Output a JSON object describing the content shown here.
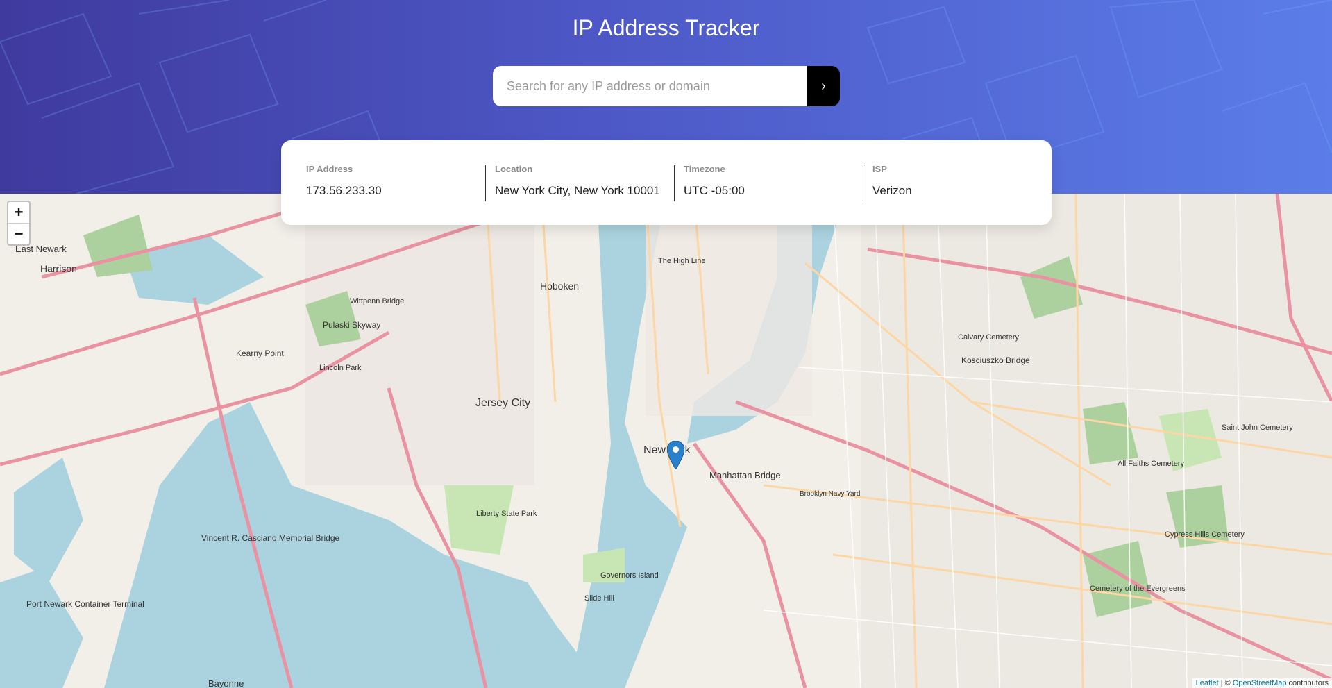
{
  "app": {
    "title": "IP Address Tracker"
  },
  "search": {
    "placeholder": "Search for any IP address or domain",
    "value": "",
    "button_icon": "chevron-right-icon"
  },
  "info": {
    "ip_label": "IP Address",
    "ip_value": "173.56.233.30",
    "location_label": "Location",
    "location_value": "New York City, New York 10001",
    "timezone_label": "Timezone",
    "timezone_value": "UTC -05:00",
    "isp_label": "ISP",
    "isp_value": "Verizon"
  },
  "map": {
    "zoom_in": "+",
    "zoom_out": "−",
    "attribution_leaflet": "Leaflet",
    "attribution_sep": " | © ",
    "attribution_osm": "OpenStreetMap",
    "attribution_suffix": " contributors",
    "labels": {
      "east_newark": "East Newark",
      "harrison": "Harrison",
      "hoboken": "Hoboken",
      "jersey_city": "Jersey City",
      "new_york": "New York",
      "manhattan_bridge": "Manhattan Bridge",
      "kosciuszko": "Kosciuszko Bridge",
      "calvary": "Calvary Cemetery",
      "liberty": "Liberty State Park",
      "governors": "Governors Island",
      "bayonne": "Bayonne",
      "port_newark": "Port Newark Container Terminal",
      "kearny": "Kearny Point",
      "pulaski": "Pulaski Skyway",
      "vincent": "Vincent R. Casciano Memorial Bridge",
      "high_line": "The High Line",
      "brooklyn_navy": "Brooklyn Navy Yard",
      "saint_john": "Saint John Cemetery",
      "cypress": "Cypress Hills Cemetery",
      "evergreens": "Cemetery of the Evergreens",
      "all_faiths": "All Faiths Cemetery",
      "lincoln": "Lincoln Park",
      "wittpenn": "Wittpenn Bridge",
      "slide_hill": "Slide Hill"
    }
  }
}
